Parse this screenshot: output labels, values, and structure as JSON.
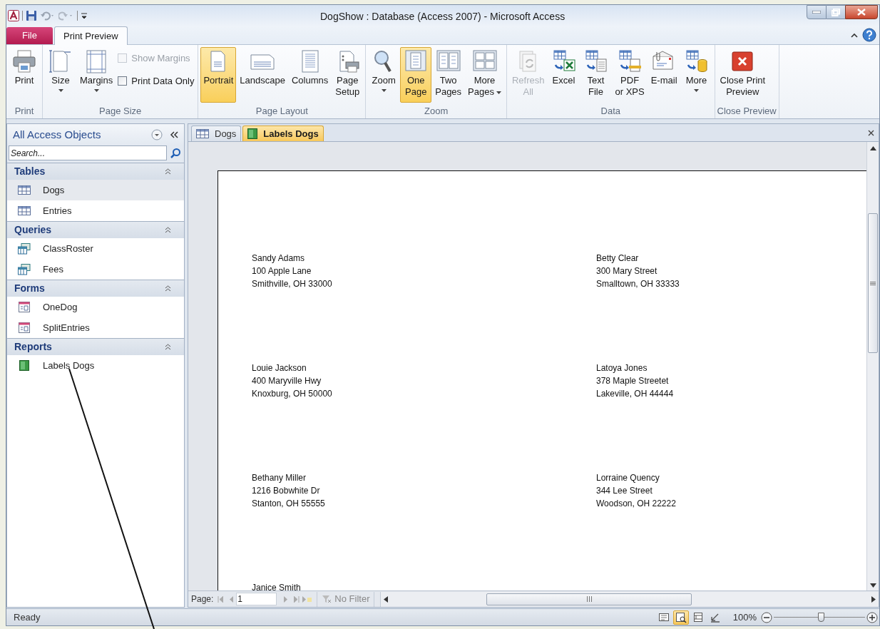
{
  "window": {
    "title": "DogShow : Database (Access 2007)  -  Microsoft Access"
  },
  "ribbon": {
    "tabs": [
      {
        "label": "File",
        "kind": "file",
        "selected": false
      },
      {
        "label": "Print Preview",
        "kind": "tab",
        "selected": true
      }
    ],
    "groups": [
      {
        "label": "Print",
        "buttons": [
          {
            "kind": "large",
            "label": "Print",
            "selected": false,
            "disabled": false
          }
        ]
      },
      {
        "label": "Page Size",
        "buttons": [
          {
            "kind": "large",
            "label": "Size",
            "selected": false,
            "disabled": false,
            "dropdown": true,
            "inline_caret": false
          },
          {
            "kind": "large",
            "label": "Margins",
            "selected": false,
            "disabled": false,
            "dropdown": true,
            "inline_caret": false
          },
          {
            "kind": "checks",
            "items": [
              {
                "label": "Show Margins",
                "checked": false,
                "disabled": true
              },
              {
                "label": "Print Data Only",
                "checked": false,
                "disabled": false
              }
            ]
          }
        ]
      },
      {
        "label": "Page Layout",
        "buttons": [
          {
            "kind": "large",
            "label": "Portrait",
            "selected": true,
            "disabled": false
          },
          {
            "kind": "large",
            "label": "Landscape",
            "selected": false,
            "disabled": false
          },
          {
            "kind": "large",
            "label": "Columns",
            "selected": false,
            "disabled": false
          },
          {
            "kind": "large",
            "label": "Page\nSetup",
            "selected": false,
            "disabled": false
          }
        ]
      },
      {
        "label": "Zoom",
        "buttons": [
          {
            "kind": "large",
            "label": "Zoom",
            "selected": false,
            "disabled": false,
            "dropdown": true,
            "inline_caret": false
          },
          {
            "kind": "large",
            "label": "One\nPage",
            "selected": true,
            "disabled": false
          },
          {
            "kind": "large",
            "label": "Two\nPages",
            "selected": false,
            "disabled": false
          },
          {
            "kind": "large",
            "label": "More\nPages",
            "selected": false,
            "disabled": false,
            "dropdown": true,
            "inline_caret": true
          }
        ]
      },
      {
        "label": "Data",
        "buttons": [
          {
            "kind": "large",
            "label": "Refresh\nAll",
            "selected": false,
            "disabled": true
          },
          {
            "kind": "large",
            "label": "Excel",
            "selected": false,
            "disabled": false
          },
          {
            "kind": "large",
            "label": "Text\nFile",
            "selected": false,
            "disabled": false
          },
          {
            "kind": "large",
            "label": "PDF\nor XPS",
            "selected": false,
            "disabled": false
          },
          {
            "kind": "large",
            "label": "E-mail",
            "selected": false,
            "disabled": false
          },
          {
            "kind": "large",
            "label": "More",
            "selected": false,
            "disabled": false,
            "dropdown": true,
            "inline_caret": false
          }
        ]
      },
      {
        "label": "Close Preview",
        "buttons": [
          {
            "kind": "large",
            "label": "Close Print\nPreview",
            "selected": false,
            "disabled": false
          }
        ]
      }
    ]
  },
  "navigation_pane": {
    "title": "All Access Objects",
    "search": {
      "placeholder": "Search..."
    },
    "sections": [
      {
        "label": "Tables",
        "expanded": true,
        "items": [
          {
            "label": "Dogs",
            "kind": "table",
            "selected": true
          },
          {
            "label": "Entries",
            "kind": "table",
            "selected": false
          }
        ]
      },
      {
        "label": "Queries",
        "expanded": true,
        "items": [
          {
            "label": "ClassRoster",
            "kind": "query",
            "selected": false
          },
          {
            "label": "Fees",
            "kind": "query",
            "selected": false
          }
        ]
      },
      {
        "label": "Forms",
        "expanded": true,
        "items": [
          {
            "label": "OneDog",
            "kind": "form",
            "selected": false
          },
          {
            "label": "SplitEntries",
            "kind": "form",
            "selected": false
          }
        ]
      },
      {
        "label": "Reports",
        "expanded": true,
        "items": [
          {
            "label": "Labels Dogs",
            "kind": "report",
            "selected": false
          }
        ]
      }
    ]
  },
  "document_tabs": [
    {
      "label": "Dogs",
      "kind": "table",
      "selected": false
    },
    {
      "label": "Labels Dogs",
      "kind": "report",
      "selected": true
    }
  ],
  "report_labels": [
    {
      "lines": [
        "Sandy Adams",
        "100 Apple Lane",
        "Smithville, OH 33000"
      ]
    },
    {
      "lines": [
        "Betty Clear",
        "300 Mary Street",
        "Smalltown, OH 33333"
      ]
    },
    {
      "lines": [
        "Louie Jackson",
        "400 Maryville Hwy",
        "Knoxburg, OH 50000"
      ]
    },
    {
      "lines": [
        "Latoya Jones",
        "378 Maple Streetet",
        "Lakeville, OH 44444"
      ]
    },
    {
      "lines": [
        "Bethany Miller",
        "1216 Bobwhite Dr",
        "Stanton, OH 55555"
      ]
    },
    {
      "lines": [
        "Lorraine Quency",
        "344 Lee Street",
        "Woodson, OH 22222"
      ]
    },
    {
      "lines": [
        "Janice Smith"
      ]
    }
  ],
  "record_navigator": {
    "label": "Page:",
    "value": "1",
    "filter": "No Filter"
  },
  "status_bar": {
    "text": "Ready",
    "views": [
      {
        "selected": false
      },
      {
        "selected": true
      },
      {
        "selected": false
      },
      {
        "selected": false
      }
    ],
    "zoom": "100%",
    "zoom_level": {
      "level": 0.52
    }
  }
}
